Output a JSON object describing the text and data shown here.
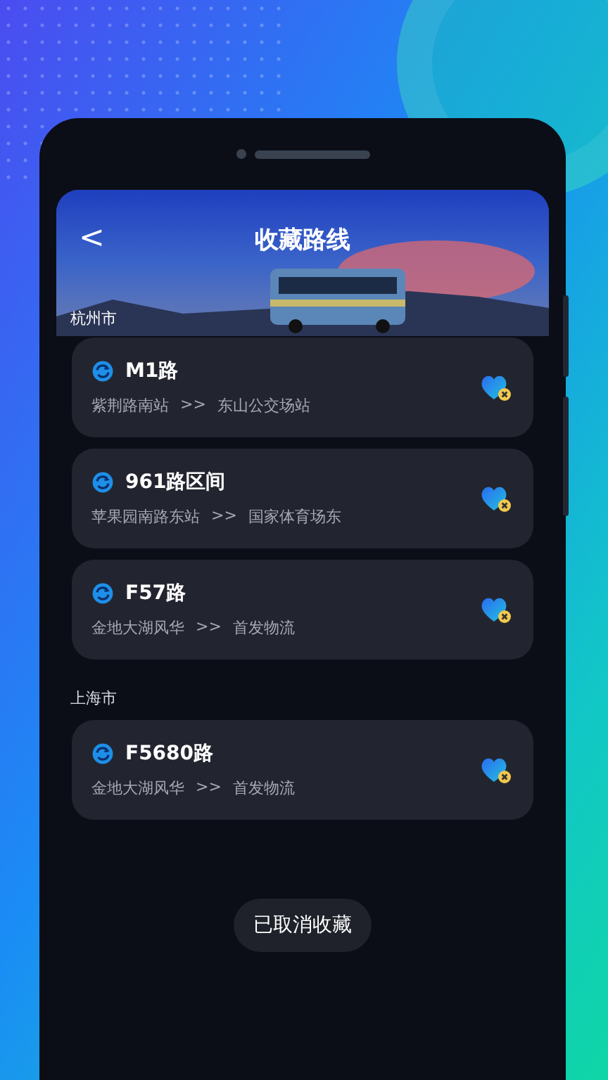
{
  "header": {
    "back_icon": "<",
    "title": "收藏路线"
  },
  "groups": [
    {
      "city": "杭州市",
      "routes": [
        {
          "name": "M1路",
          "from": "紫荆路南站",
          "separator": ">>",
          "to": "东山公交场站"
        },
        {
          "name": "961路区间",
          "from": "苹果园南路东站",
          "separator": ">>",
          "to": "国家体育场东"
        },
        {
          "name": "F57路",
          "from": "金地大湖风华",
          "separator": ">>",
          "to": "首发物流"
        }
      ]
    },
    {
      "city": "上海市",
      "routes": [
        {
          "name": "F5680路",
          "from": "金地大湖风华",
          "separator": ">>",
          "to": "首发物流"
        }
      ]
    }
  ],
  "toast": "已取消收藏"
}
